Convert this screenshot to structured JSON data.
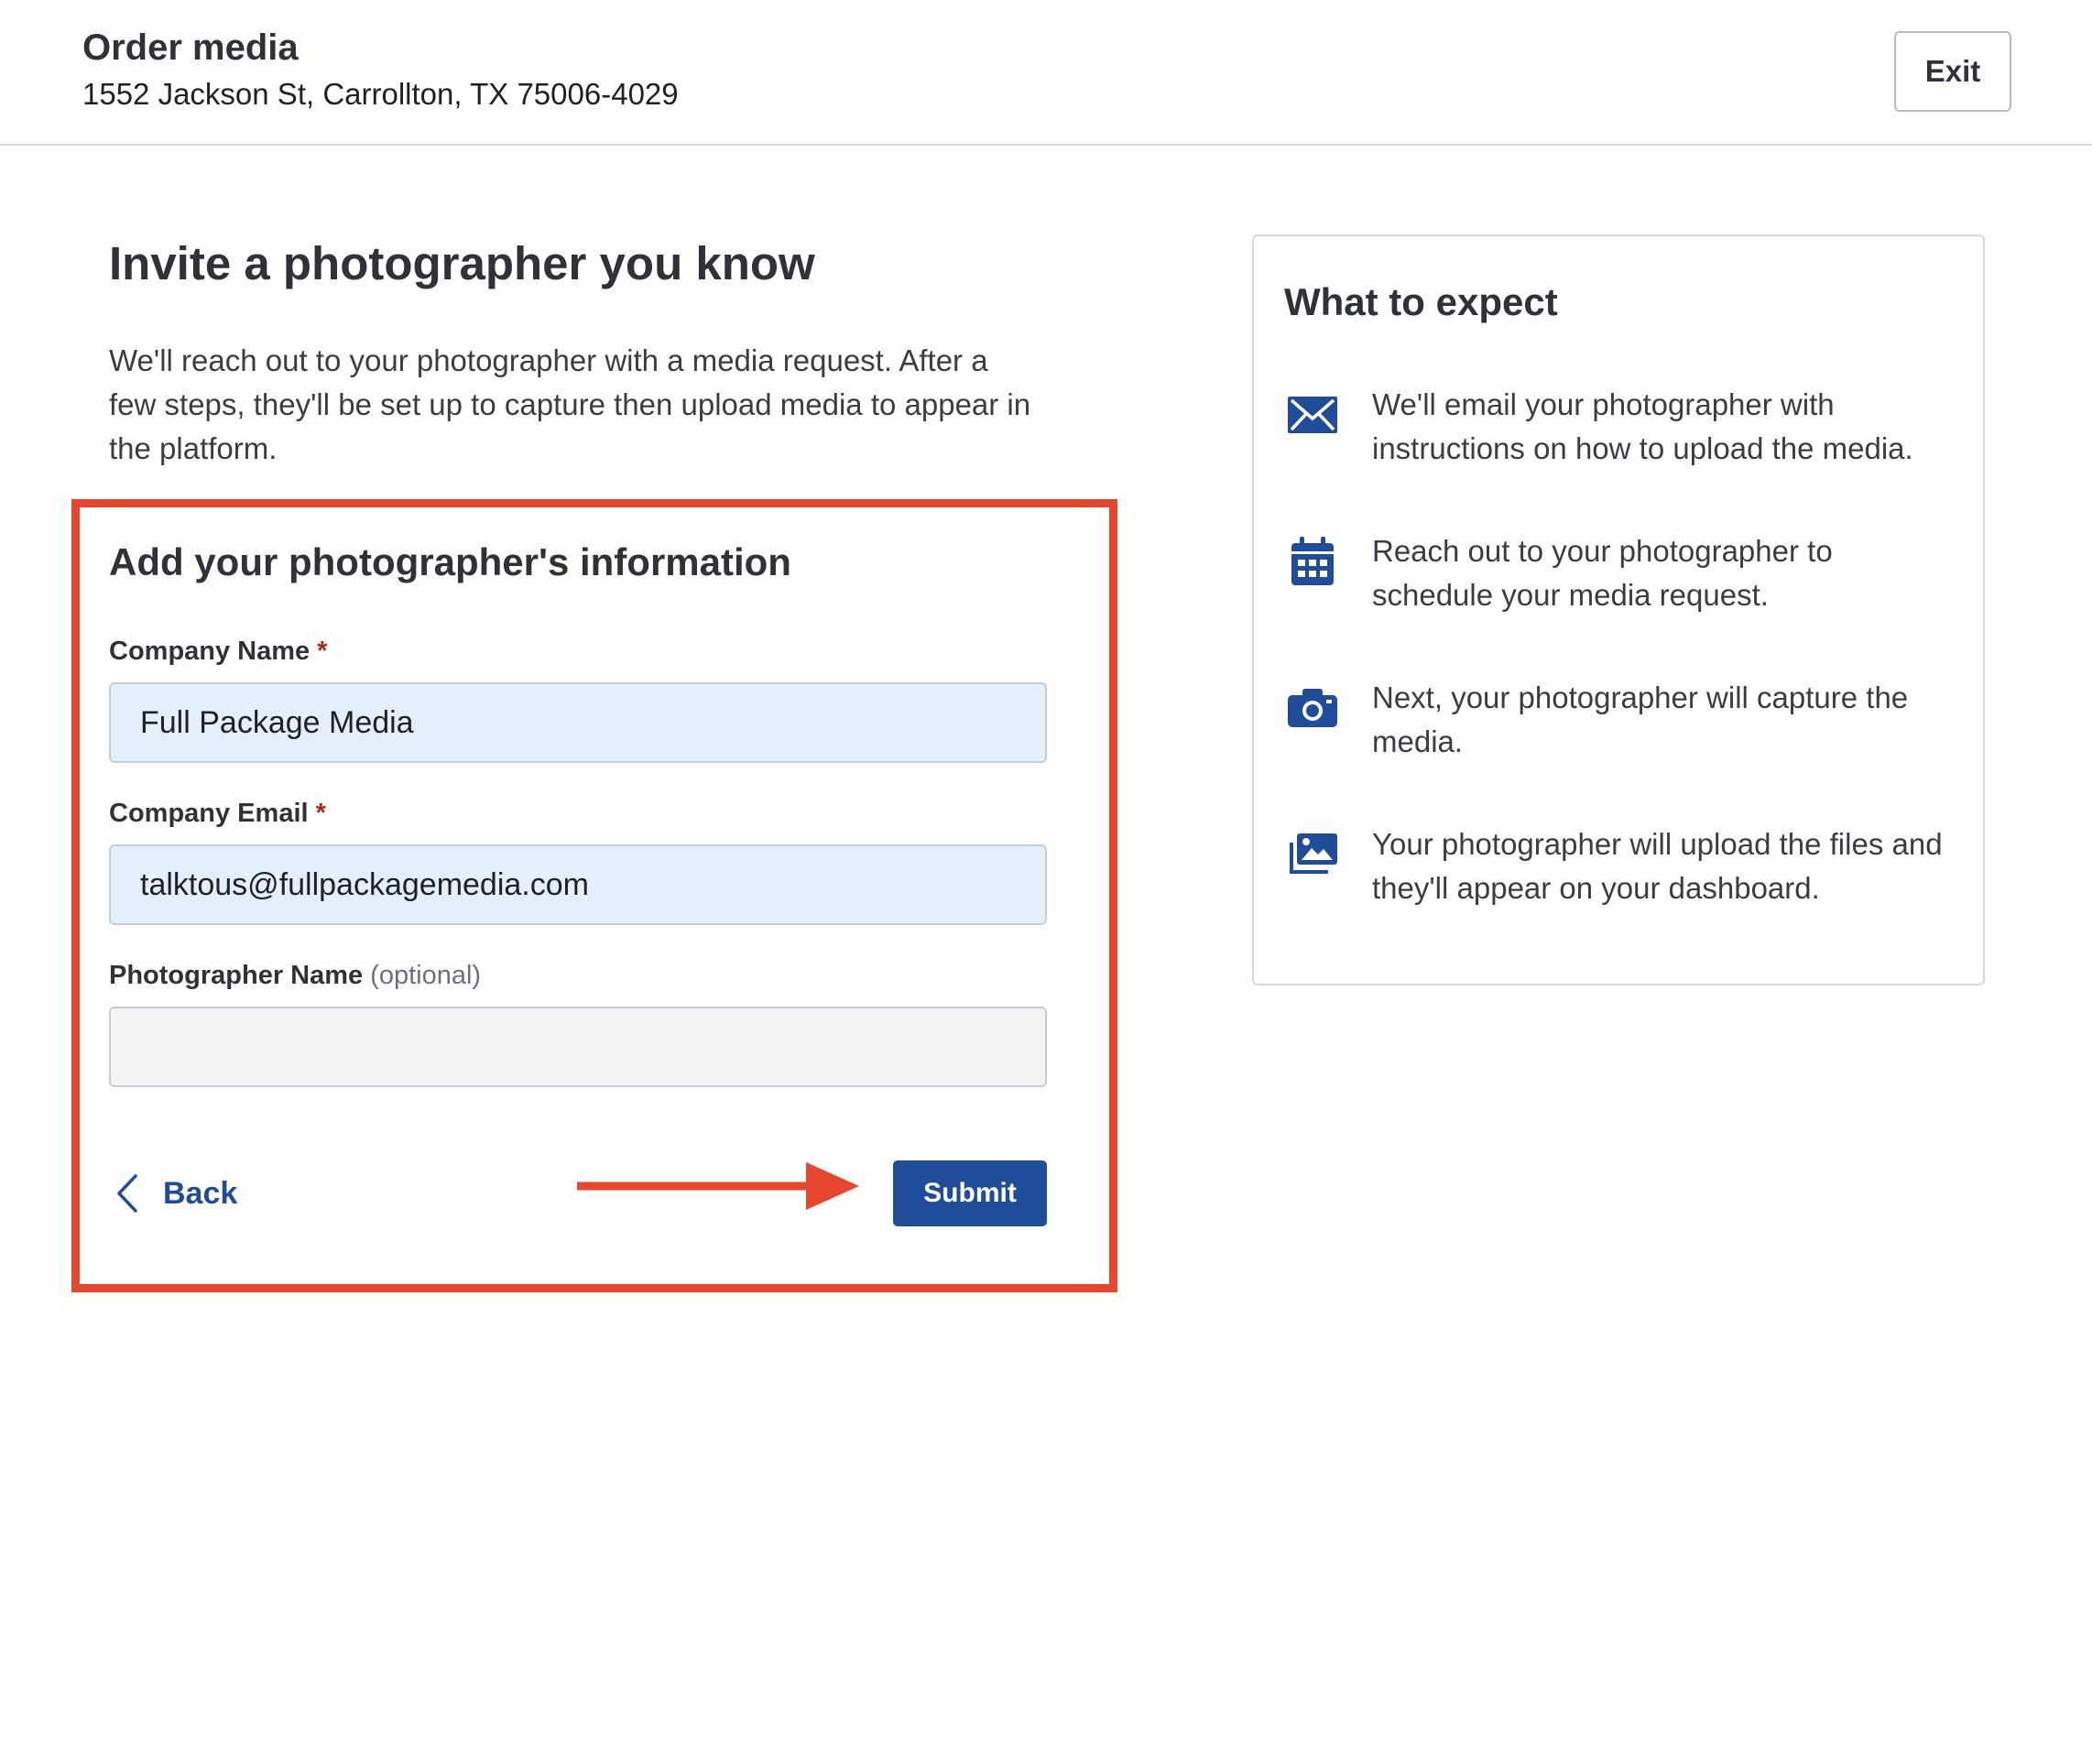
{
  "header": {
    "title": "Order media",
    "address": "1552 Jackson St, Carrollton, TX 75006-4029",
    "exit_label": "Exit"
  },
  "main": {
    "heading": "Invite a photographer you know",
    "intro": "We'll reach out to your photographer with a media request. After a few steps, they'll be set up to capture then upload media to appear in the platform."
  },
  "form": {
    "heading": "Add your photographer's information",
    "fields": [
      {
        "label": "Company Name",
        "required_mark": "*",
        "value": "Full Package Media"
      },
      {
        "label": "Company Email",
        "required_mark": "*",
        "value": "talktous@fullpackagemedia.com"
      },
      {
        "label": "Photographer Name",
        "optional_note": "(optional)",
        "value": ""
      }
    ],
    "back_label": "Back",
    "submit_label": "Submit"
  },
  "expect": {
    "heading": "What to expect",
    "items": [
      {
        "icon": "envelope-icon",
        "text": "We'll email your photographer with instructions on how to upload the media."
      },
      {
        "icon": "calendar-icon",
        "text": "Reach out to your photographer to schedule your media request."
      },
      {
        "icon": "camera-icon",
        "text": "Next, your photographer will capture the media."
      },
      {
        "icon": "images-icon",
        "text": "Your photographer will upload the files and they'll appear on your dashboard."
      }
    ]
  },
  "colors": {
    "accent": "#1f4d9a",
    "highlight": "#e8472f",
    "required": "#b3261e",
    "filled_input": "#e3f0fb"
  }
}
